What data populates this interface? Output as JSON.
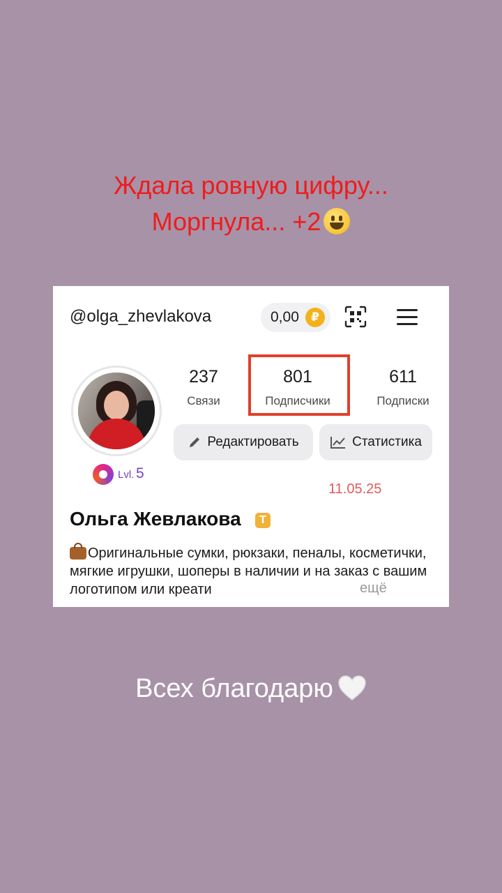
{
  "story": {
    "line1": "Ждала ровную цифру...",
    "line2": "Моргнула... +2",
    "thanks": "Всех благодарю"
  },
  "profile": {
    "handle": "@olga_zhevlakova",
    "wallet": "0,00",
    "coin_symbol": "₽",
    "level_label": "Lvl.",
    "level": "5",
    "stats": [
      {
        "value": "237",
        "label": "Связи"
      },
      {
        "value": "801",
        "label": "Подписчики"
      },
      {
        "value": "611",
        "label": "Подписки"
      }
    ],
    "edit_label": "Редактировать",
    "stats_label": "Статистика",
    "date": "11.05.25",
    "name": "Ольга Жевлакова",
    "badge": "T",
    "bio": "Оригинальные сумки, рюкзаки, пеналы, косметички, мягкие игрушки, шоперы в наличии и на заказ с вашим логотипом или креати",
    "more": "ещё"
  },
  "colors": {
    "background": "#a892a8",
    "title": "#ee1c1c",
    "highlight": "#e0402a",
    "date": "#e05a5a",
    "level": "#7a3fc4"
  }
}
